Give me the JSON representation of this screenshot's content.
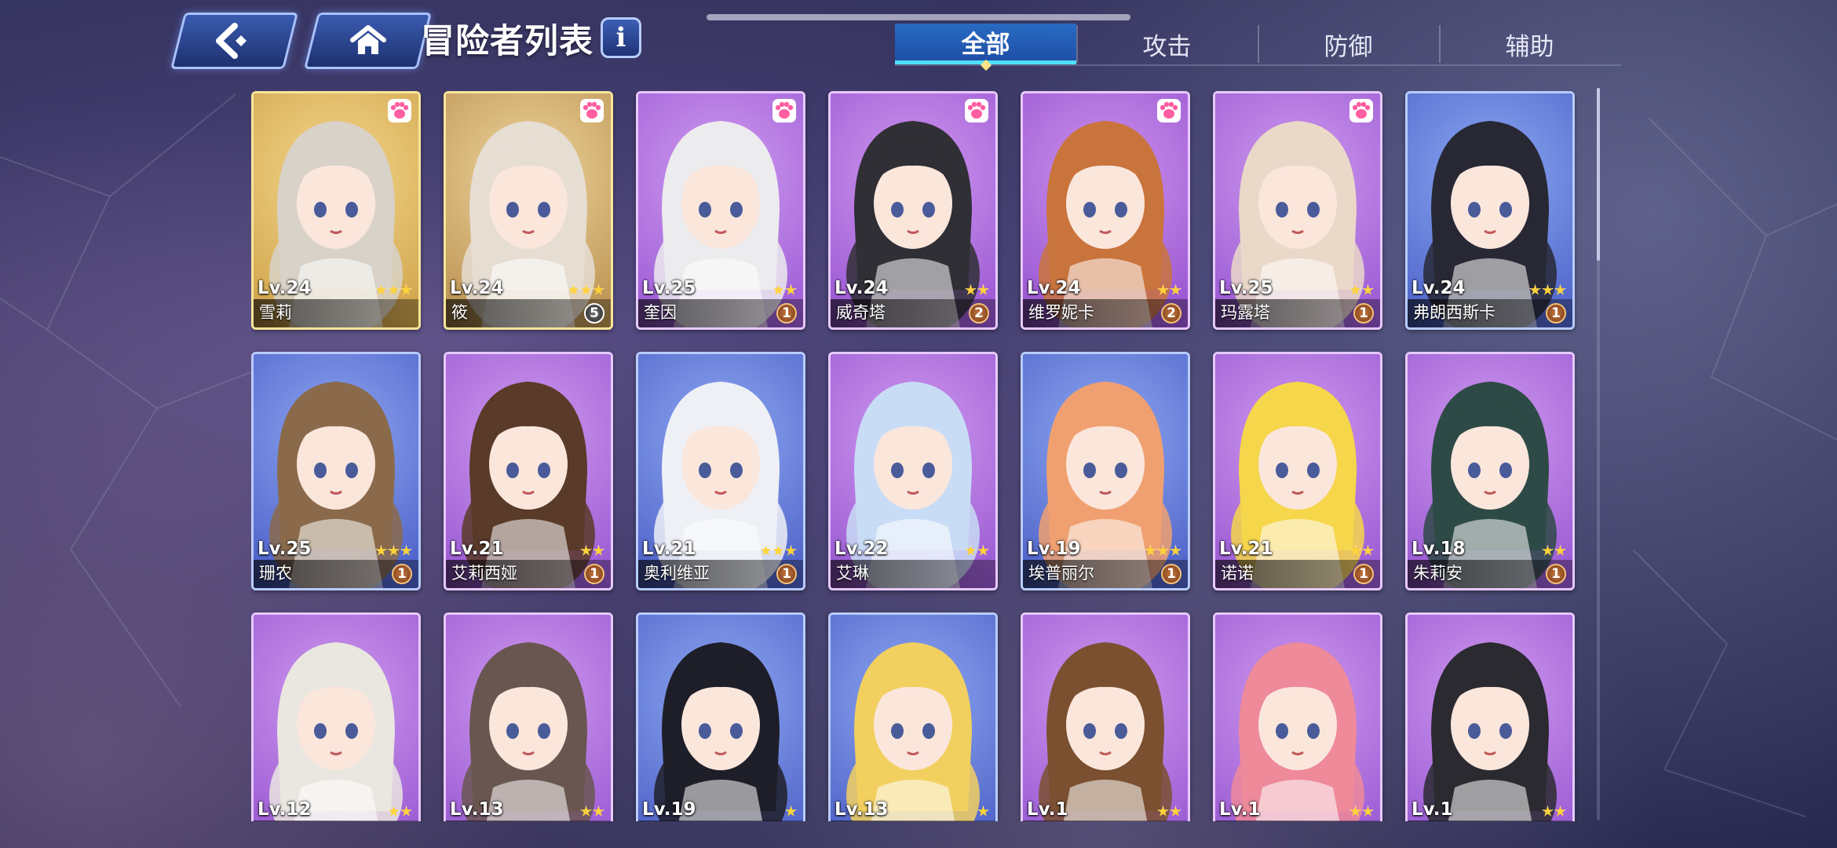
{
  "header": {
    "title": "冒险者列表",
    "back_icon": "back-arrow-icon",
    "home_icon": "home-icon",
    "info_label": "i"
  },
  "tabs": [
    {
      "label": "全部",
      "active": true
    },
    {
      "label": "攻击",
      "active": false
    },
    {
      "label": "防御",
      "active": false
    },
    {
      "label": "辅助",
      "active": false
    }
  ],
  "colors": {
    "accent": "#4fe0ff",
    "tab_active": "#2a67c4",
    "star": "#ffd43a",
    "badge_bronze": "#a85a2a"
  },
  "cards": [
    {
      "level": "Lv.24",
      "name": "雪莉",
      "stars": 3,
      "badge": "",
      "paw": true,
      "frame": "gold",
      "bg": [
        "#f3d68a",
        "#cfa24a"
      ],
      "hair": "#d8d2c8"
    },
    {
      "level": "Lv.24",
      "name": "筱",
      "stars": 3,
      "badge": "5",
      "badge_style": "white",
      "paw": true,
      "frame": "gold",
      "bg": [
        "#efd49a",
        "#b89050"
      ],
      "hair": "#e6ddd3"
    },
    {
      "level": "Lv.25",
      "name": "奎因",
      "stars": 2,
      "badge": "1",
      "paw": true,
      "frame": "purple",
      "bg": [
        "#d09af0",
        "#9a5ad4"
      ],
      "hair": "#ecebee"
    },
    {
      "level": "Lv.24",
      "name": "威奇塔",
      "stars": 2,
      "badge": "2",
      "paw": true,
      "frame": "purple",
      "bg": [
        "#cf96ee",
        "#9956d2"
      ],
      "hair": "#2f2f35"
    },
    {
      "level": "Lv.24",
      "name": "维罗妮卡",
      "stars": 2,
      "badge": "2",
      "paw": true,
      "frame": "purple",
      "bg": [
        "#cd92ec",
        "#9552d0"
      ],
      "hair": "#c9743c"
    },
    {
      "level": "Lv.25",
      "name": "玛露塔",
      "stars": 2,
      "badge": "1",
      "paw": true,
      "frame": "purple",
      "bg": [
        "#cf98ee",
        "#9858d2"
      ],
      "hair": "#ead8c8"
    },
    {
      "level": "Lv.24",
      "name": "弗朗西斯卡",
      "stars": 3,
      "badge": "1",
      "paw": false,
      "frame": "blue",
      "bg": [
        "#8aa8f2",
        "#4d62c8"
      ],
      "hair": "#282834"
    },
    {
      "level": "Lv.25",
      "name": "珊农",
      "stars": 3,
      "badge": "1",
      "paw": false,
      "frame": "blue",
      "bg": [
        "#8ea6f2",
        "#4a5ec6"
      ],
      "hair": "#8a6a4a"
    },
    {
      "level": "Lv.21",
      "name": "艾莉西娅",
      "stars": 2,
      "badge": "1",
      "paw": false,
      "frame": "purple",
      "bg": [
        "#cf98ee",
        "#9858d2"
      ],
      "hair": "#5a3a28"
    },
    {
      "level": "Lv.21",
      "name": "奥利维亚",
      "stars": 3,
      "badge": "1",
      "paw": false,
      "frame": "blue",
      "bg": [
        "#8ea8f2",
        "#4c60c6"
      ],
      "hair": "#eef0f6"
    },
    {
      "level": "Lv.22",
      "name": "艾琳",
      "stars": 2,
      "badge": "",
      "paw": false,
      "frame": "purple",
      "bg": [
        "#cf98ee",
        "#9858d2"
      ],
      "hair": "#c9dcf6"
    },
    {
      "level": "Lv.19",
      "name": "埃普丽尔",
      "stars": 3,
      "badge": "1",
      "paw": false,
      "frame": "blue",
      "bg": [
        "#8ea8f2",
        "#4c60c6"
      ],
      "hair": "#f0a070"
    },
    {
      "level": "Lv.21",
      "name": "诺诺",
      "stars": 2,
      "badge": "1",
      "paw": false,
      "frame": "purple",
      "bg": [
        "#cf98ee",
        "#9858d2"
      ],
      "hair": "#f6d64a"
    },
    {
      "level": "Lv.18",
      "name": "朱莉安",
      "stars": 2,
      "badge": "1",
      "paw": false,
      "frame": "purple",
      "bg": [
        "#cf98ee",
        "#9858d2"
      ],
      "hair": "#2e4a46"
    },
    {
      "level": "Lv.12",
      "name": "",
      "stars": 2,
      "badge": "",
      "paw": false,
      "frame": "purple",
      "bg": [
        "#cf98ee",
        "#9858d2"
      ],
      "hair": "#eae6e0"
    },
    {
      "level": "Lv.13",
      "name": "",
      "stars": 2,
      "badge": "",
      "paw": false,
      "frame": "purple",
      "bg": [
        "#cf98ee",
        "#9858d2"
      ],
      "hair": "#6a5650"
    },
    {
      "level": "Lv.19",
      "name": "",
      "stars": 1,
      "badge": "",
      "paw": false,
      "frame": "blue",
      "bg": [
        "#8ea8f2",
        "#4c60c6"
      ],
      "hair": "#1e1e28"
    },
    {
      "level": "Lv.13",
      "name": "",
      "stars": 1,
      "badge": "",
      "paw": false,
      "frame": "blue",
      "bg": [
        "#8ea8f2",
        "#4c60c6"
      ],
      "hair": "#f2d060"
    },
    {
      "level": "Lv.1",
      "name": "",
      "stars": 2,
      "badge": "",
      "paw": false,
      "frame": "purple",
      "bg": [
        "#cf98ee",
        "#9858d2"
      ],
      "hair": "#7a5030"
    },
    {
      "level": "Lv.1",
      "name": "",
      "stars": 2,
      "badge": "",
      "paw": false,
      "frame": "purple",
      "bg": [
        "#cf98ee",
        "#9858d2"
      ],
      "hair": "#ee8a9a"
    },
    {
      "level": "Lv.1",
      "name": "",
      "stars": 2,
      "badge": "",
      "paw": false,
      "frame": "purple",
      "bg": [
        "#cf98ee",
        "#9858d2"
      ],
      "hair": "#2a2a30"
    }
  ]
}
